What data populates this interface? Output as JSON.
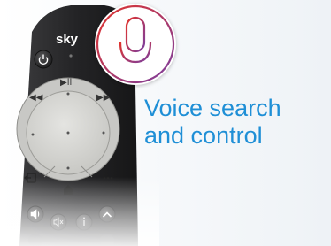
{
  "caption": {
    "line1": "Voice search",
    "line2": "and control"
  },
  "remote": {
    "brand": "sky"
  },
  "icons": [
    "power-icon",
    "rewind-icon",
    "play-pause-icon",
    "fast-forward-icon",
    "back-icon",
    "home-icon",
    "more-icon",
    "volume-icon",
    "mute-icon",
    "info-icon",
    "channel-up-icon",
    "microphone-icon"
  ],
  "colors": {
    "caption_text": "#1f8fd6",
    "mic_gradient_start": "#e2332b",
    "mic_gradient_end": "#7b3fa0",
    "remote_body": "#2a2a2c",
    "touch_ring": "#c9c9c6",
    "center_pad": "#d8d8d5"
  }
}
